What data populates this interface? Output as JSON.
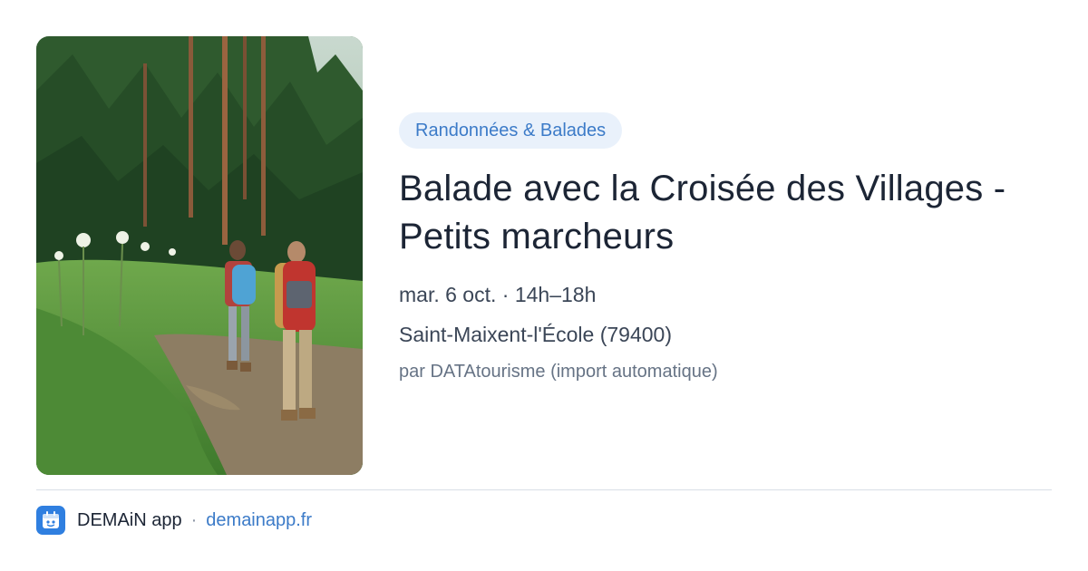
{
  "event": {
    "category": "Randonnées & Balades",
    "title": "Balade avec la Croisée des Villages - Petits marcheurs",
    "when": "mar. 6 oct. · 14h–18h",
    "where": "Saint-Maixent-l'École (79400)",
    "source": "par DATAtourisme (import automatique)"
  },
  "footer": {
    "app_name": "DEMAiN app",
    "separator": "·",
    "site": "demainapp.fr"
  },
  "colors": {
    "accent": "#3c7bc8",
    "badge_bg": "#e9f1fb",
    "logo_bg": "#2f7fe0"
  },
  "icons": {
    "logo": "demain-app-logo-icon"
  }
}
